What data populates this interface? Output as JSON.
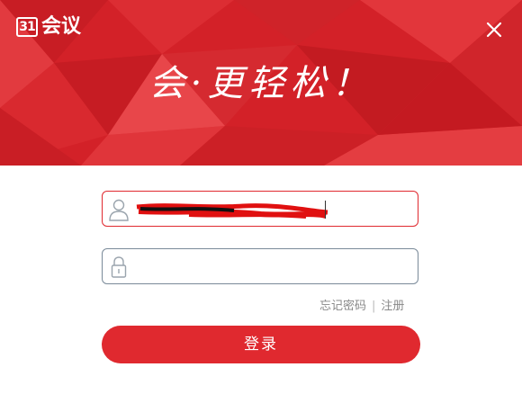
{
  "app": {
    "logo_mark": "31",
    "logo_text": "会议"
  },
  "banner": {
    "slogan": "会·更轻松！",
    "background_color": "#d8262c"
  },
  "login_form": {
    "username": {
      "value": "",
      "icon": "user-icon"
    },
    "password": {
      "value": "",
      "icon": "lock-icon"
    },
    "forgot_password": "忘记密码",
    "separator": "|",
    "register": "注册",
    "submit_label": "登录"
  },
  "colors": {
    "accent": "#e0292f",
    "close_icon": "#ffffff"
  }
}
